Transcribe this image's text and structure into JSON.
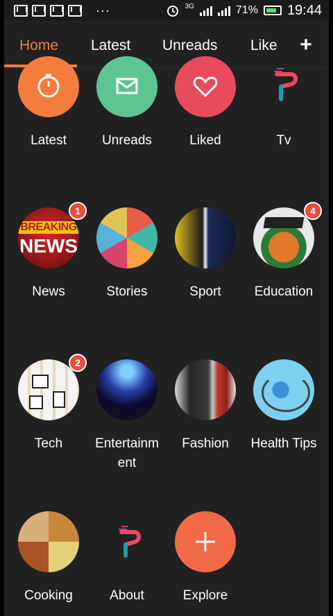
{
  "status_bar": {
    "dots": "···",
    "network": "3G",
    "battery": "71%",
    "time": "19:44",
    "icons": [
      "gmail-icon",
      "gmail-icon",
      "gmail-icon",
      "gmail-icon",
      "alarm-icon",
      "signal-icon",
      "battery-icon"
    ]
  },
  "tabs": [
    {
      "label": "Home",
      "active": true
    },
    {
      "label": "Latest",
      "active": false
    },
    {
      "label": "Unreads",
      "active": false
    },
    {
      "label": "Like",
      "active": false
    }
  ],
  "add_tab_label": "+",
  "grid": [
    {
      "label": "Latest",
      "icon": "stopwatch-icon",
      "color": "#f47c3c"
    },
    {
      "label": "Unreads",
      "icon": "mail-icon",
      "color": "#5ec490"
    },
    {
      "label": "Liked",
      "icon": "heart-icon",
      "color": "#e84b5c"
    },
    {
      "label": "Tv",
      "icon": "p-logo-icon"
    },
    {
      "label": "News",
      "icon": "breaking-news-image",
      "badge": "1",
      "image_text": [
        "BREAKING",
        "NEWS"
      ]
    },
    {
      "label": "Stories",
      "icon": "books-image"
    },
    {
      "label": "Sport",
      "icon": "football-image"
    },
    {
      "label": "Education",
      "icon": "graduation-globe-image",
      "badge": "4"
    },
    {
      "label": "Tech",
      "icon": "tech-devices-image",
      "badge": "2"
    },
    {
      "label": "Entertainm\nent",
      "icon": "concert-image"
    },
    {
      "label": "Fashion",
      "icon": "fashion-image"
    },
    {
      "label": "Health Tips",
      "icon": "stethoscope-globe-image"
    },
    {
      "label": "Cooking",
      "icon": "food-image"
    },
    {
      "label": "About",
      "icon": "p-logo-icon"
    },
    {
      "label": "Explore",
      "icon": "plus-icon",
      "color": "#f26b47"
    }
  ]
}
